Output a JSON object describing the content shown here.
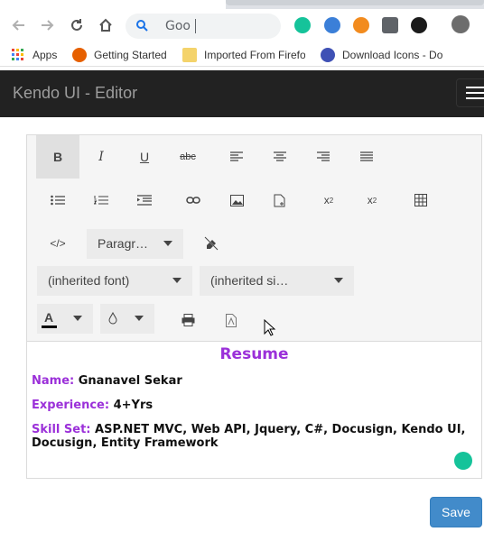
{
  "browser": {
    "address_text": "Goo",
    "bookmarks": [
      {
        "label": "Apps",
        "icon": "apps-grid-icon"
      },
      {
        "label": "Getting Started",
        "icon": "firefox-icon"
      },
      {
        "label": "Imported From Firefox",
        "icon": "folder-icon"
      },
      {
        "label": "Download Icons - Do",
        "icon": "star-badge-icon"
      }
    ]
  },
  "app": {
    "brand": "Kendo UI - Editor"
  },
  "editor": {
    "format_dropdown": "Paragr…",
    "font_dropdown": "(inherited font)",
    "size_dropdown": "(inherited si…",
    "tools_row1": [
      "bold",
      "italic",
      "underline",
      "strikethrough",
      "justify-left",
      "justify-center",
      "justify-right",
      "justify-full"
    ],
    "tools_row2": [
      "unordered-list",
      "ordered-list",
      "indent",
      "insert-link",
      "insert-image",
      "insert-file",
      "subscript",
      "superscript",
      "create-table"
    ],
    "content": {
      "title": "Resume",
      "fields": [
        {
          "label": "Name:",
          "value": "Gnanavel Sekar"
        },
        {
          "label": "Experience:",
          "value": "4+Yrs"
        },
        {
          "label": "Skill Set:",
          "value": "ASP.NET MVC, Web API, Jquery, C#, Docusign, Kendo UI, Docusign, Entity Framework"
        }
      ]
    }
  },
  "actions": {
    "save_label": "Save"
  },
  "colors": {
    "accent_purple": "#9b30d9",
    "primary_blue": "#428bca",
    "navbar": "#222222"
  }
}
